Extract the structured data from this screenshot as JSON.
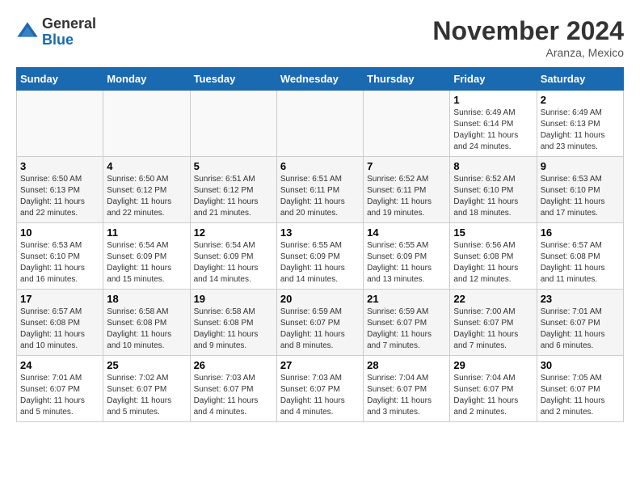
{
  "header": {
    "logo_line1": "General",
    "logo_line2": "Blue",
    "month_title": "November 2024",
    "location": "Aranza, Mexico"
  },
  "weekdays": [
    "Sunday",
    "Monday",
    "Tuesday",
    "Wednesday",
    "Thursday",
    "Friday",
    "Saturday"
  ],
  "weeks": [
    [
      {
        "day": "",
        "info": ""
      },
      {
        "day": "",
        "info": ""
      },
      {
        "day": "",
        "info": ""
      },
      {
        "day": "",
        "info": ""
      },
      {
        "day": "",
        "info": ""
      },
      {
        "day": "1",
        "info": "Sunrise: 6:49 AM\nSunset: 6:14 PM\nDaylight: 11 hours and 24 minutes."
      },
      {
        "day": "2",
        "info": "Sunrise: 6:49 AM\nSunset: 6:13 PM\nDaylight: 11 hours and 23 minutes."
      }
    ],
    [
      {
        "day": "3",
        "info": "Sunrise: 6:50 AM\nSunset: 6:13 PM\nDaylight: 11 hours and 22 minutes."
      },
      {
        "day": "4",
        "info": "Sunrise: 6:50 AM\nSunset: 6:12 PM\nDaylight: 11 hours and 22 minutes."
      },
      {
        "day": "5",
        "info": "Sunrise: 6:51 AM\nSunset: 6:12 PM\nDaylight: 11 hours and 21 minutes."
      },
      {
        "day": "6",
        "info": "Sunrise: 6:51 AM\nSunset: 6:11 PM\nDaylight: 11 hours and 20 minutes."
      },
      {
        "day": "7",
        "info": "Sunrise: 6:52 AM\nSunset: 6:11 PM\nDaylight: 11 hours and 19 minutes."
      },
      {
        "day": "8",
        "info": "Sunrise: 6:52 AM\nSunset: 6:10 PM\nDaylight: 11 hours and 18 minutes."
      },
      {
        "day": "9",
        "info": "Sunrise: 6:53 AM\nSunset: 6:10 PM\nDaylight: 11 hours and 17 minutes."
      }
    ],
    [
      {
        "day": "10",
        "info": "Sunrise: 6:53 AM\nSunset: 6:10 PM\nDaylight: 11 hours and 16 minutes."
      },
      {
        "day": "11",
        "info": "Sunrise: 6:54 AM\nSunset: 6:09 PM\nDaylight: 11 hours and 15 minutes."
      },
      {
        "day": "12",
        "info": "Sunrise: 6:54 AM\nSunset: 6:09 PM\nDaylight: 11 hours and 14 minutes."
      },
      {
        "day": "13",
        "info": "Sunrise: 6:55 AM\nSunset: 6:09 PM\nDaylight: 11 hours and 14 minutes."
      },
      {
        "day": "14",
        "info": "Sunrise: 6:55 AM\nSunset: 6:09 PM\nDaylight: 11 hours and 13 minutes."
      },
      {
        "day": "15",
        "info": "Sunrise: 6:56 AM\nSunset: 6:08 PM\nDaylight: 11 hours and 12 minutes."
      },
      {
        "day": "16",
        "info": "Sunrise: 6:57 AM\nSunset: 6:08 PM\nDaylight: 11 hours and 11 minutes."
      }
    ],
    [
      {
        "day": "17",
        "info": "Sunrise: 6:57 AM\nSunset: 6:08 PM\nDaylight: 11 hours and 10 minutes."
      },
      {
        "day": "18",
        "info": "Sunrise: 6:58 AM\nSunset: 6:08 PM\nDaylight: 11 hours and 10 minutes."
      },
      {
        "day": "19",
        "info": "Sunrise: 6:58 AM\nSunset: 6:08 PM\nDaylight: 11 hours and 9 minutes."
      },
      {
        "day": "20",
        "info": "Sunrise: 6:59 AM\nSunset: 6:07 PM\nDaylight: 11 hours and 8 minutes."
      },
      {
        "day": "21",
        "info": "Sunrise: 6:59 AM\nSunset: 6:07 PM\nDaylight: 11 hours and 7 minutes."
      },
      {
        "day": "22",
        "info": "Sunrise: 7:00 AM\nSunset: 6:07 PM\nDaylight: 11 hours and 7 minutes."
      },
      {
        "day": "23",
        "info": "Sunrise: 7:01 AM\nSunset: 6:07 PM\nDaylight: 11 hours and 6 minutes."
      }
    ],
    [
      {
        "day": "24",
        "info": "Sunrise: 7:01 AM\nSunset: 6:07 PM\nDaylight: 11 hours and 5 minutes."
      },
      {
        "day": "25",
        "info": "Sunrise: 7:02 AM\nSunset: 6:07 PM\nDaylight: 11 hours and 5 minutes."
      },
      {
        "day": "26",
        "info": "Sunrise: 7:03 AM\nSunset: 6:07 PM\nDaylight: 11 hours and 4 minutes."
      },
      {
        "day": "27",
        "info": "Sunrise: 7:03 AM\nSunset: 6:07 PM\nDaylight: 11 hours and 4 minutes."
      },
      {
        "day": "28",
        "info": "Sunrise: 7:04 AM\nSunset: 6:07 PM\nDaylight: 11 hours and 3 minutes."
      },
      {
        "day": "29",
        "info": "Sunrise: 7:04 AM\nSunset: 6:07 PM\nDaylight: 11 hours and 2 minutes."
      },
      {
        "day": "30",
        "info": "Sunrise: 7:05 AM\nSunset: 6:07 PM\nDaylight: 11 hours and 2 minutes."
      }
    ]
  ]
}
